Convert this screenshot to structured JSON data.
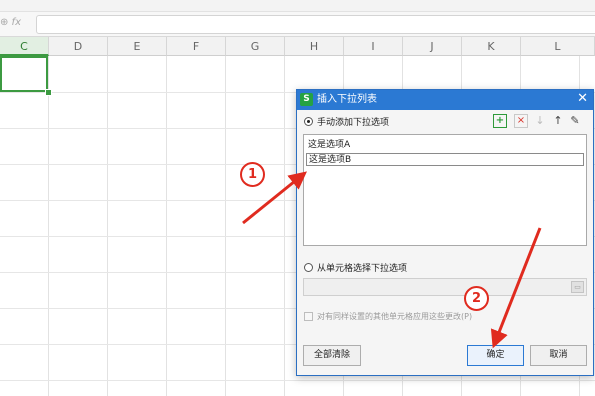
{
  "formula_bar": {
    "icons": "⊕ fx",
    "value": ""
  },
  "columns": [
    {
      "id": "col-c",
      "label": "C",
      "active": true
    },
    {
      "id": "col-d",
      "label": "D"
    },
    {
      "id": "col-e",
      "label": "E"
    },
    {
      "id": "col-f",
      "label": "F"
    },
    {
      "id": "col-g",
      "label": "G"
    },
    {
      "id": "col-h",
      "label": "H"
    },
    {
      "id": "col-i",
      "label": "I"
    },
    {
      "id": "col-j",
      "label": "J"
    },
    {
      "id": "col-k",
      "label": "K"
    },
    {
      "id": "col-l",
      "label": "L"
    }
  ],
  "dialog": {
    "logo": "S",
    "title": "插入下拉列表",
    "close": "✕",
    "manual_option": "手动添加下拉选项",
    "items": [
      "这是选项A",
      "这是选项B"
    ],
    "cell_option": "从单元格选择下拉选项",
    "apply_all": "对有同样设置的其他单元格应用这些更改(P)",
    "clear_all": "全部清除",
    "ok": "确定",
    "cancel": "取消",
    "tools": {
      "add": "+",
      "delete": "×",
      "down": "↓",
      "up": "↑",
      "edit": "✎"
    }
  },
  "annotations": {
    "step1": "1",
    "step2": "2"
  },
  "colors": {
    "accent_green": "#3c9a41",
    "dialog_blue": "#2b79d3",
    "annotation_red": "#e02b1f"
  }
}
